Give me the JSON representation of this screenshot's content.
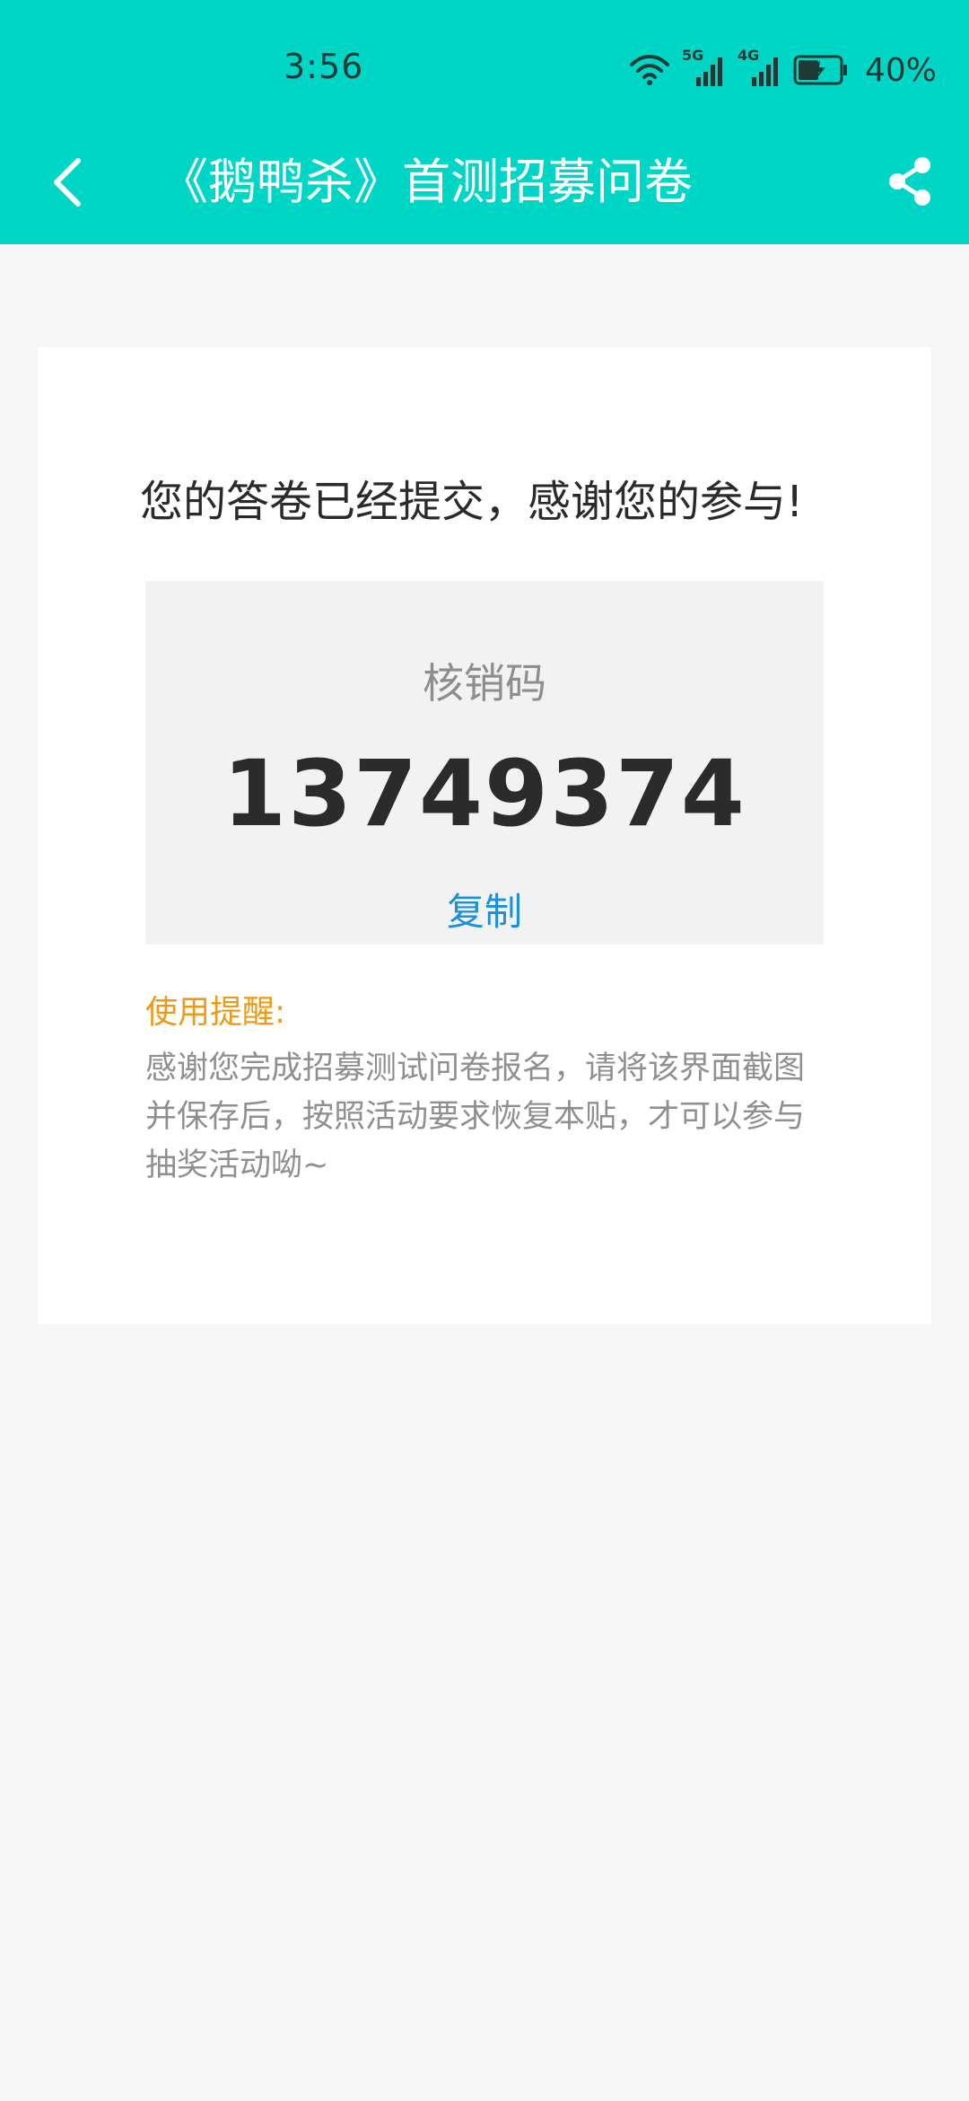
{
  "status_bar": {
    "time": "3:56",
    "network_5g": "5G",
    "network_4g": "4G",
    "battery_percent": "40%"
  },
  "nav": {
    "title": "《鹅鸭杀》首测招募问卷",
    "back_icon": "chevron-left-icon",
    "share_icon": "share-icon"
  },
  "card": {
    "success_message": "您的答卷已经提交，感谢您的参与!",
    "code_label": "核销码",
    "code_value": "13749374",
    "copy_label": "复制",
    "reminder_title": "使用提醒:",
    "reminder_body": "感谢您完成招募测试问卷报名，请将该界面截图并保存后，按照活动要求恢复本贴，才可以参与抽奖活动呦~"
  },
  "colors": {
    "accent": "#00d6c6",
    "link": "#1a8fdc",
    "reminder": "#ef9a16"
  }
}
